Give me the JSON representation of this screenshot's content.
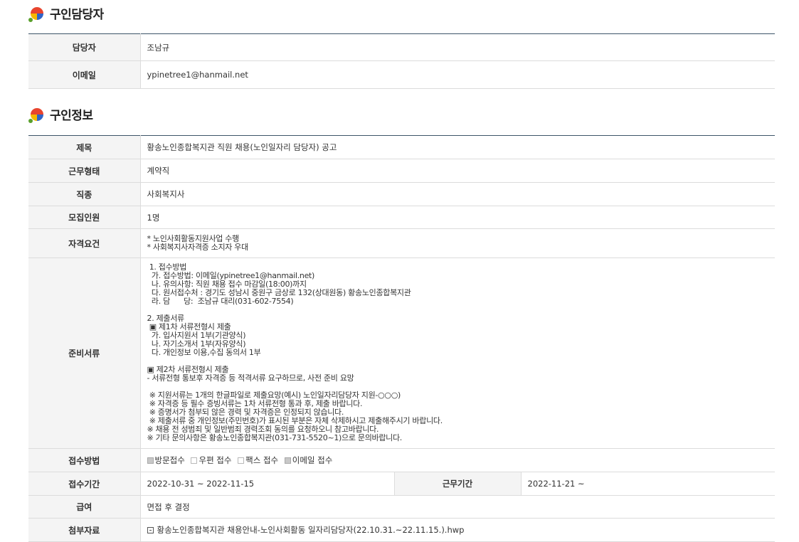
{
  "contact_section": {
    "title": "구인담당자",
    "rows": [
      {
        "label": "담당자",
        "value": "조남규"
      },
      {
        "label": "이메일",
        "value": "ypinetree1@hanmail.net"
      }
    ]
  },
  "job_section": {
    "title": "구인정보",
    "title_row": {
      "label": "제목",
      "value": "황송노인종합복지관 직원 채용(노인일자리 담당자) 공고"
    },
    "work_type": {
      "label": "근무형태",
      "value": "계약직"
    },
    "occupation": {
      "label": "직종",
      "value": "사회복지사"
    },
    "openings": {
      "label": "모집인원",
      "value": "1명"
    },
    "qualifications": {
      "label": "자격요건",
      "lines": [
        "* 노인사회활동지원사업 수행",
        "* 사회복지사자격증 소지자 우대"
      ]
    },
    "documents": {
      "label": "준비서류",
      "lines": [
        " 1. 접수방법",
        "  가. 접수방법: 이메일(ypinetree1@hanmail.net)",
        "  나. 유의사항: 직원 채용 접수 마감일(18:00)까지",
        "  다. 원서접수처 : 경기도 성남시 중원구 금상로 132(상대원동) 황송노인종합복지관",
        "  라. 담      당:  조남규 대리(031-602-7554)",
        "",
        "2. 제출서류",
        " ▣ 제1차 서류전형시 제출",
        "  가. 입사지원서 1부(기관양식)",
        "  나. 자기소개서 1부(자유양식)",
        "  다. 개인정보 이용,수집 동의서 1부",
        "",
        "▣ 제2차 서류전형시 제출",
        "- 서류전형 통보후 자격증 등 적격서류 요구하므로, 사전 준비 요망",
        "",
        " ※ 지원서류는 1개의 한글파일로 제출요망(예시) 노인일자리담당자 지원-○○○)",
        " ※ 자격증 등 필수 증빙서류는 1차 서류전형 통과 후, 제출 바랍니다.",
        " ※ 증명서가 첨부되 않은 경력 및 자격증은 인정되지 않습니다.",
        " ※ 제출서류 중 개인정보(주민번호)가 표시된 부분은 자체 삭제하시고 제출해주시기 바랍니다.",
        "※ 채용 전 성범죄 및 일반범죄 경력조회 동의를 요청하오니 참고바랍니다.",
        "※ 기타 문의사항은 황송노인종합복지관(031-731-5520~1)으로 문의바랍니다."
      ]
    },
    "apply_method": {
      "label": "접수방법",
      "options": [
        {
          "label": "방문접수",
          "checked": true
        },
        {
          "label": "우편 접수",
          "checked": false
        },
        {
          "label": "팩스 접수",
          "checked": false
        },
        {
          "label": "이메일 접수",
          "checked": true
        }
      ]
    },
    "period": {
      "label": "접수기간",
      "value": "2022-10-31 ~ 2022-11-15",
      "work_label": "근무기간",
      "work_value": "2022-11-21 ~"
    },
    "salary": {
      "label": "급여",
      "value": "면접 후 결정"
    },
    "attachment": {
      "label": "첨부자료",
      "value": "황송노인종합복지관 채용안내-노인사회활동 일자리담당자(22.10.31.~22.11.15.).hwp"
    }
  },
  "colors": {
    "header_line": "#3c5468",
    "label_bg": "#f4f4f4",
    "icon_red": "#e8442e",
    "icon_blue": "#2f64c8",
    "icon_yellow": "#f5b800",
    "icon_green": "#5aa02c"
  },
  "icons": {
    "section_icon": "colorful-circle-icon",
    "attachment_icon": "file-icon"
  }
}
